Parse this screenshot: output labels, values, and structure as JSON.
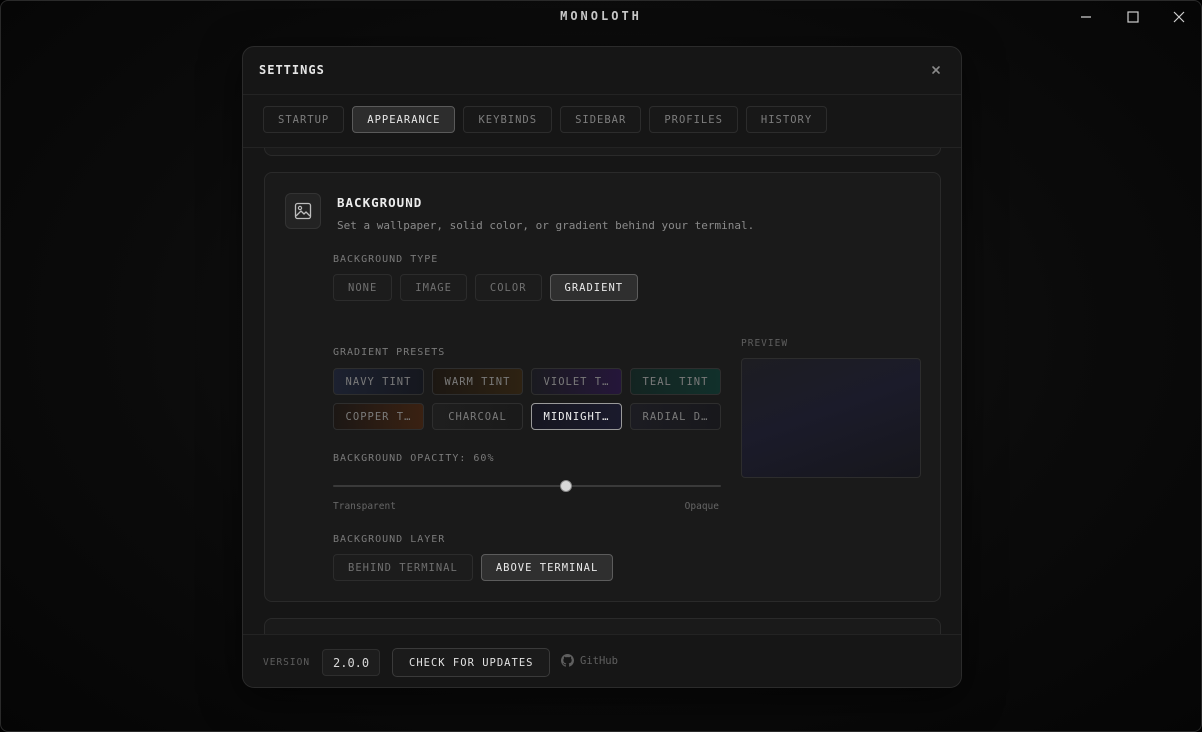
{
  "window": {
    "title": "MONOLOTH"
  },
  "settings": {
    "title": "SETTINGS",
    "tabs": [
      {
        "label": "STARTUP",
        "active": false
      },
      {
        "label": "APPEARANCE",
        "active": true
      },
      {
        "label": "KEYBINDS",
        "active": false
      },
      {
        "label": "SIDEBAR",
        "active": false
      },
      {
        "label": "PROFILES",
        "active": false
      },
      {
        "label": "HISTORY",
        "active": false
      }
    ]
  },
  "background": {
    "icon": "image-icon",
    "title": "BACKGROUND",
    "description": "Set a wallpaper, solid color, or gradient behind your terminal.",
    "type_label": "BACKGROUND TYPE",
    "types": [
      {
        "label": "NONE",
        "active": false
      },
      {
        "label": "IMAGE",
        "active": false
      },
      {
        "label": "COLOR",
        "active": false
      },
      {
        "label": "GRADIENT",
        "active": true
      }
    ],
    "presets_label": "GRADIENT PRESETS",
    "presets": [
      {
        "label": "NAVY TINT",
        "active": false,
        "color_a": "#1c2130",
        "color_b": "#15171e"
      },
      {
        "label": "WARM TINT",
        "active": false,
        "color_a": "#1c1712",
        "color_b": "#2e2212"
      },
      {
        "label": "VIOLET T…",
        "active": false,
        "color_a": "#1a1a20",
        "color_b": "#25163a"
      },
      {
        "label": "TEAL TINT",
        "active": false,
        "color_a": "#132421",
        "color_b": "#11302b"
      },
      {
        "label": "COPPER T…",
        "active": false,
        "color_a": "#1c1714",
        "color_b": "#3a2112"
      },
      {
        "label": "CHARCOAL",
        "active": false,
        "color_a": "#1e1e1e",
        "color_b": "#1a1a1a"
      },
      {
        "label": "MIDNIGHT…",
        "active": true,
        "color_a": "#161620",
        "color_b": "#1a1a2c"
      },
      {
        "label": "RADIAL D…",
        "active": false,
        "color_a": "#1c1c22",
        "color_b": "#18181c"
      }
    ],
    "opacity_label": "BACKGROUND OPACITY: 60%",
    "opacity_value": 60,
    "slider_min_label": "Transparent",
    "slider_max_label": "Opaque",
    "preview_label": "PREVIEW",
    "layer_label": "BACKGROUND LAYER",
    "layers": [
      {
        "label": "BEHIND TERMINAL",
        "active": false
      },
      {
        "label": "ABOVE TERMINAL",
        "active": true
      }
    ]
  },
  "footer": {
    "version_label": "VERSION",
    "version": "2.0.0",
    "update_button": "CHECK FOR UPDATES",
    "github_label": "GitHub",
    "github_icon": "github-icon"
  }
}
